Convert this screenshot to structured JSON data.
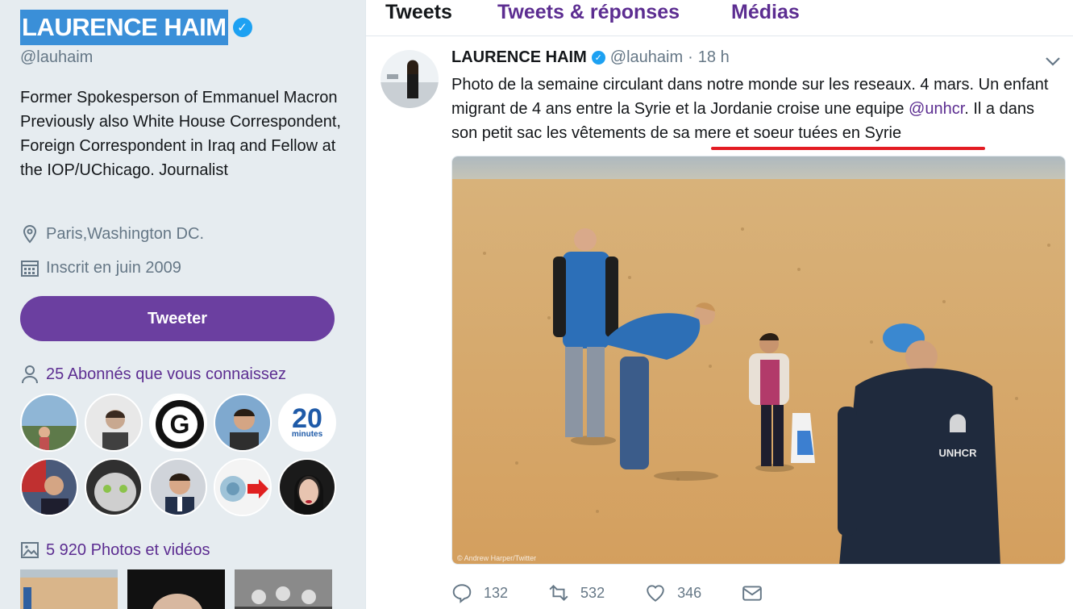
{
  "profile": {
    "name": "LAURENCE HAIM",
    "handle": "@lauhaim",
    "bio": "Former Spokesperson of Emmanuel Macron Previously also White House Correspondent, Foreign Correspondent in Iraq and Fellow at the IOP/UChicago. Journalist",
    "location": "Paris,Washington DC.",
    "joined": "Inscrit en juin 2009",
    "tweet_button": "Tweeter",
    "followers_you_know": "25 Abonnés que vous connaissez",
    "photos_videos": "5 920 Photos et vidéos",
    "follower_avatar_20min_text": "20",
    "follower_avatar_20min_sub": "minutes"
  },
  "tabs": [
    "Tweets",
    "Tweets & réponses",
    "Médias"
  ],
  "tweet": {
    "name": "LAURENCE HAIM",
    "handle": "@lauhaim",
    "separator": "·",
    "time": "18 h",
    "text_part1": "Photo de la semaine circulant dans notre monde sur les reseaux.  4 mars. Un enfant migrant  de 4 ans entre la Syrie et la Jordanie croise une equipe ",
    "mention": "@unhcr",
    "text_part2": ". Il a dans son petit sac les vêtements  de sa mere et soeur tuées en Syrie",
    "photo_credit": "© Andrew Harper/Twitter",
    "vest_label": "UNHCR",
    "replies": "132",
    "retweets": "532",
    "likes": "346"
  },
  "colors": {
    "accent": "#5c2d91",
    "button": "#6b3fa0",
    "verified": "#1da1f2",
    "underline": "#e31b23"
  }
}
